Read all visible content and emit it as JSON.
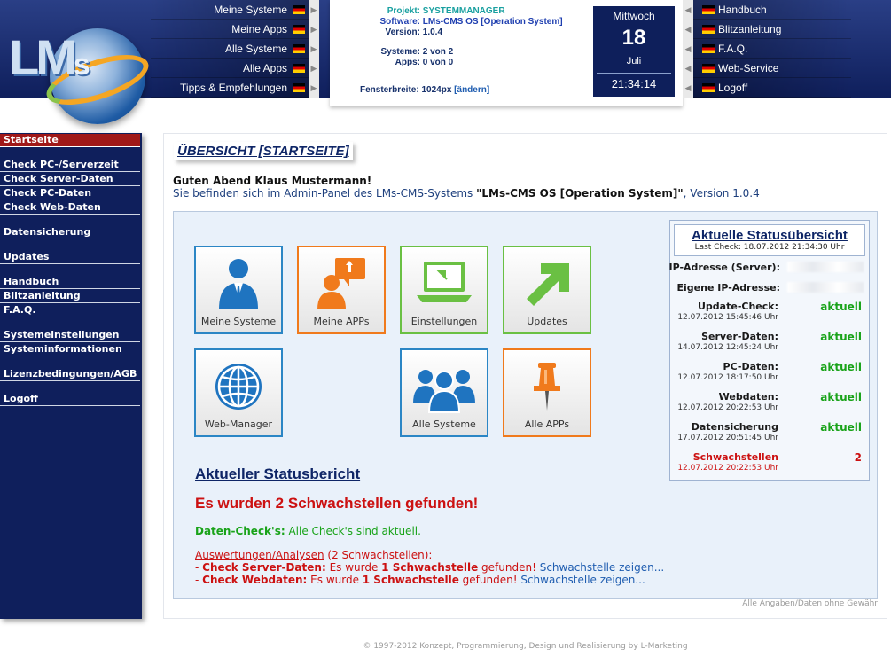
{
  "header": {
    "nav_left": [
      "Meine Systeme",
      "Meine Apps",
      "Alle Systeme",
      "Alle Apps",
      "Tipps & Empfehlungen"
    ],
    "nav_right": [
      "Handbuch",
      "Blitzanleitung",
      "F.A.Q.",
      "Web-Service",
      "Logoff"
    ],
    "info": {
      "projekt_label": "Projekt:",
      "projekt_value": "SYSTEMMANAGER",
      "software_label": "Software:",
      "software_value": "LMs-CMS OS [Operation System]",
      "version_label": "Version:",
      "version_value": "1.0.4",
      "systeme_label": "Systeme:",
      "systeme_value": "2 von 2",
      "apps_label": "Apps:",
      "apps_value": "0 von 0",
      "fenster_label": "Fensterbreite:",
      "fenster_value": "1024px",
      "fenster_link": "[ändern]"
    },
    "date": {
      "weekday": "Mittwoch",
      "day": "18",
      "month": "Juli",
      "time": "21:34:14"
    }
  },
  "sidebar": {
    "items": [
      "Startseite",
      "Check PC-/Serverzeit",
      "Check Server-Daten",
      "Check PC-Daten",
      "Check Web-Daten",
      "Datensicherung",
      "Updates",
      "Handbuch",
      "Blitzanleitung",
      "F.A.Q.",
      "Systemeinstellungen",
      "Systeminformationen",
      "Lizenzbedingungen/AGB",
      "Logoff"
    ]
  },
  "main": {
    "title": "ÜBERSICHT [STARTSEITE]",
    "greeting": "Guten Abend Klaus Mustermann!",
    "subtitle_prefix": "Sie befinden sich im Admin-Panel des LMs-CMS-Systems ",
    "subtitle_name": "\"LMs-CMS OS [Operation System]\"",
    "subtitle_suffix": ", Version 1.0.4",
    "tiles": [
      "Meine Systeme",
      "Meine APPs",
      "Einstellungen",
      "Updates",
      "Web-Manager",
      "Alle Systeme",
      "Alle APPs"
    ]
  },
  "status": {
    "title": "Aktuelle Statusübersicht",
    "last_check": "Last Check: 18.07.2012 21:34:30 Uhr",
    "ip_server_label": "IP-Adresse (Server):",
    "ip_own_label": "Eigene IP-Adresse:",
    "rows": [
      {
        "label": "Update-Check:",
        "date": "12.07.2012 15:45:46 Uhr",
        "value": "aktuell"
      },
      {
        "label": "Server-Daten:",
        "date": "14.07.2012 12:45:24 Uhr",
        "value": "aktuell"
      },
      {
        "label": "PC-Daten:",
        "date": "12.07.2012 18:17:50 Uhr",
        "value": "aktuell"
      },
      {
        "label": "Webdaten:",
        "date": "12.07.2012 20:22:53 Uhr",
        "value": "aktuell"
      },
      {
        "label": "Datensicherung",
        "date": "17.07.2012 20:51:45 Uhr",
        "value": "aktuell"
      },
      {
        "label": "Schwachstellen",
        "date": "12.07.2012 20:22:53 Uhr",
        "value": "2"
      }
    ]
  },
  "report": {
    "title": "Aktueller Statusbericht",
    "alert": "Es wurden 2 Schwachstellen gefunden!",
    "data_check_label": "Daten-Check's:",
    "data_check_text": " Alle Check's sind aktuell.",
    "analysis_label": "Auswertungen/Analysen",
    "analysis_count": " (2 Schwachstellen):",
    "lines": [
      {
        "prefix": "- ",
        "name": "Check Server-Daten:",
        "text": " Es wurde ",
        "count": "1 Schwachstelle",
        "suffix": " gefunden! ",
        "link": "Schwachstelle zeigen..."
      },
      {
        "prefix": "- ",
        "name": "Check Webdaten:",
        "text": " Es wurde ",
        "count": "1 Schwachstelle",
        "suffix": " gefunden! ",
        "link": "Schwachstelle zeigen..."
      }
    ]
  },
  "disclaimer": "Alle Angaben/Daten ohne Gewähr",
  "footer": "© 1997-2012 Konzept, Programmierung, Design und Realisierung by L-Marketing",
  "colors": {
    "navy": "#0f1f5c",
    "active": "#a01818",
    "green": "#19a319",
    "red": "#cc1111",
    "tile_blue": "#2b86c5",
    "tile_orange": "#f07a1c",
    "tile_green": "#6ac043"
  }
}
